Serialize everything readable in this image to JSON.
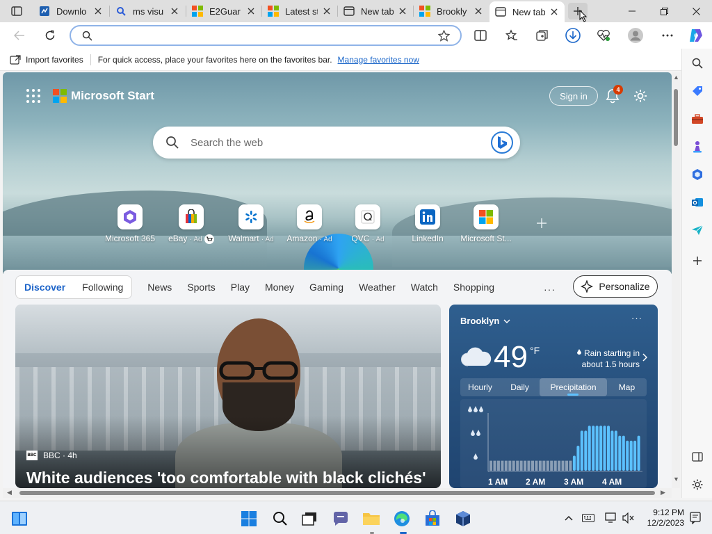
{
  "browser": {
    "tabs": [
      {
        "title": "Downlo",
        "favicon": "downloads-page-icon",
        "active": false
      },
      {
        "title": "ms visu",
        "favicon": "search-icon",
        "active": false
      },
      {
        "title": "E2Guar",
        "favicon": "microsoft-logo-icon",
        "active": false
      },
      {
        "title": "Latest st",
        "favicon": "microsoft-logo-icon",
        "active": false
      },
      {
        "title": "New tab",
        "favicon": "newtab-page-icon",
        "active": false
      },
      {
        "title": "Brookly",
        "favicon": "microsoft-logo-icon",
        "active": false
      },
      {
        "title": "New tab",
        "favicon": "newtab-page-icon",
        "active": true
      }
    ],
    "address": {
      "value": "",
      "placeholder": ""
    },
    "favorites_bar": {
      "import_label": "Import favorites",
      "hint": "For quick access, place your favorites here on the favorites bar.",
      "manage_link": "Manage favorites now"
    }
  },
  "page": {
    "brand": "Microsoft Start",
    "signin": "Sign in",
    "notification_count": "4",
    "search": {
      "placeholder": "Search the web"
    },
    "quick_links": [
      {
        "label": "Microsoft 365",
        "ad": "",
        "icon": "microsoft365-icon"
      },
      {
        "label": "eBay",
        "ad": "· Ad",
        "icon": "ebay-icon"
      },
      {
        "label": "Walmart",
        "ad": "· Ad",
        "icon": "walmart-icon"
      },
      {
        "label": "Amazon",
        "ad": "· Ad",
        "icon": "amazon-icon"
      },
      {
        "label": "QVC",
        "ad": "· Ad",
        "icon": "qvc-icon"
      },
      {
        "label": "LinkedIn",
        "ad": "",
        "icon": "linkedin-icon"
      },
      {
        "label": "Microsoft St...",
        "ad": "",
        "icon": "microsoft-store-icon"
      }
    ],
    "feed_nav": {
      "primary": [
        "Discover",
        "Following"
      ],
      "links": [
        "News",
        "Sports",
        "Play",
        "Money",
        "Gaming",
        "Weather",
        "Watch",
        "Shopping"
      ],
      "more": "···",
      "personalize": "Personalize"
    },
    "hero_story": {
      "source": "BBC · 4h",
      "headline": "White audiences 'too comfortable with black clichés'"
    },
    "weather": {
      "location": "Brooklyn",
      "temperature": "49",
      "unit": "°F",
      "alert": "Rain starting in about 1.5 hours",
      "tabs": [
        "Hourly",
        "Daily",
        "Precipitation",
        "Map"
      ],
      "active_tab": "Precipitation",
      "time_labels": [
        "1 AM",
        "2 AM",
        "3 AM",
        "4 AM"
      ],
      "precip_bars": [
        2,
        2,
        2,
        2,
        2,
        2,
        2,
        2,
        2,
        2,
        2,
        2,
        2,
        2,
        2,
        2,
        2,
        2,
        2,
        2,
        2,
        2,
        3,
        5,
        8,
        8,
        9,
        9,
        9,
        9,
        9,
        9,
        8,
        8,
        7,
        7,
        6,
        6,
        6,
        7
      ]
    }
  },
  "taskbar": {
    "clock_time": "9:12 PM",
    "clock_date": "12/2/2023"
  },
  "colors": {
    "accent": "#1d64c9",
    "badge": "#d83b01",
    "weather_bg": "#27507d",
    "precip_bar": "#5cc1ff"
  }
}
